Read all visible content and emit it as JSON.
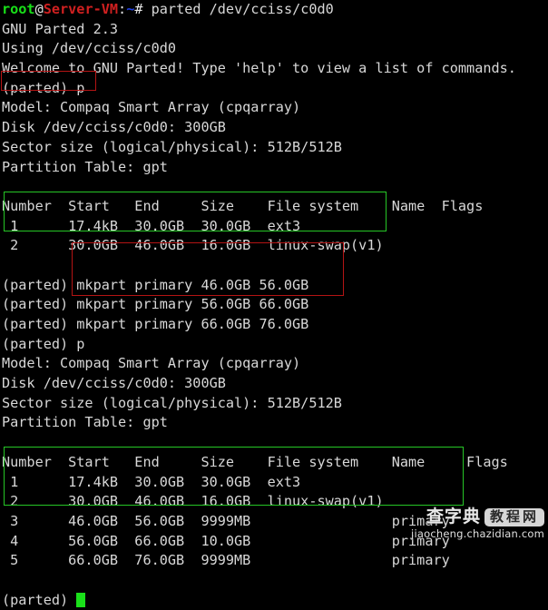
{
  "terminal": {
    "background_color": "#000000",
    "foreground_color": "#d8d8d8",
    "cursor_color": "#1ae01a",
    "prompt": {
      "user": "root",
      "at": "@",
      "host": "Server-VM",
      "colon": ":",
      "path": "~",
      "sigil": "# ",
      "user_color": "#18e018",
      "host_color": "#d02020",
      "path_color": "#2040e0"
    },
    "lines": [
      {
        "id": "l01",
        "type": "prompt",
        "command": "parted /dev/cciss/c0d0"
      },
      {
        "id": "l02",
        "type": "text",
        "text": "GNU Parted 2.3"
      },
      {
        "id": "l03",
        "type": "text",
        "text": "Using /dev/cciss/c0d0"
      },
      {
        "id": "l04",
        "type": "text",
        "text": "Welcome to GNU Parted! Type 'help' to view a list of commands."
      },
      {
        "id": "l05",
        "type": "text",
        "text": "(parted) p"
      },
      {
        "id": "l06",
        "type": "text",
        "text": "Model: Compaq Smart Array (cpqarray)"
      },
      {
        "id": "l07",
        "type": "text",
        "text": "Disk /dev/cciss/c0d0: 300GB"
      },
      {
        "id": "l08",
        "type": "text",
        "text": "Sector size (logical/physical): 512B/512B"
      },
      {
        "id": "l09",
        "type": "text",
        "text": "Partition Table: gpt"
      },
      {
        "id": "l10",
        "type": "text",
        "text": ""
      },
      {
        "id": "l11",
        "type": "text",
        "text": "Number  Start   End     Size    File system    Name  Flags"
      },
      {
        "id": "l12",
        "type": "text",
        "text": " 1      17.4kB  30.0GB  30.0GB  ext3"
      },
      {
        "id": "l13",
        "type": "text",
        "text": " 2      30.0GB  46.0GB  16.0GB  linux-swap(v1)"
      },
      {
        "id": "l14",
        "type": "text",
        "text": ""
      },
      {
        "id": "l15",
        "type": "text",
        "text": "(parted) mkpart primary 46.0GB 56.0GB"
      },
      {
        "id": "l16",
        "type": "text",
        "text": "(parted) mkpart primary 56.0GB 66.0GB"
      },
      {
        "id": "l17",
        "type": "text",
        "text": "(parted) mkpart primary 66.0GB 76.0GB"
      },
      {
        "id": "l18",
        "type": "text",
        "text": "(parted) p"
      },
      {
        "id": "l19",
        "type": "text",
        "text": "Model: Compaq Smart Array (cpqarray)"
      },
      {
        "id": "l20",
        "type": "text",
        "text": "Disk /dev/cciss/c0d0: 300GB"
      },
      {
        "id": "l21",
        "type": "text",
        "text": "Sector size (logical/physical): 512B/512B"
      },
      {
        "id": "l22",
        "type": "text",
        "text": "Partition Table: gpt"
      },
      {
        "id": "l23",
        "type": "text",
        "text": ""
      },
      {
        "id": "l24",
        "type": "text",
        "text": "Number  Start   End     Size    File system    Name     Flags"
      },
      {
        "id": "l25",
        "type": "text",
        "text": " 1      17.4kB  30.0GB  30.0GB  ext3"
      },
      {
        "id": "l26",
        "type": "text",
        "text": " 2      30.0GB  46.0GB  16.0GB  linux-swap(v1)"
      },
      {
        "id": "l27",
        "type": "text",
        "text": " 3      46.0GB  56.0GB  9999MB                 primary"
      },
      {
        "id": "l28",
        "type": "text",
        "text": " 4      56.0GB  66.0GB  10.0GB                 primary"
      },
      {
        "id": "l29",
        "type": "text",
        "text": " 5      66.0GB  76.0GB  9999MB                 primary"
      },
      {
        "id": "l30",
        "type": "text",
        "text": ""
      },
      {
        "id": "l31",
        "type": "cursor_prompt",
        "text": "(parted) "
      }
    ],
    "highlights": [
      {
        "id": "hl-print-command-1",
        "color": "#b41414",
        "label": "red-box-print-command"
      },
      {
        "id": "hl-partition-table-1",
        "color": "#26c626",
        "label": "green-box-existing-partitions"
      },
      {
        "id": "hl-mkpart-commands",
        "color": "#b41414",
        "label": "red-box-mkpart-commands"
      },
      {
        "id": "hl-partition-table-2",
        "color": "#26c626",
        "label": "green-box-new-partitions"
      }
    ]
  },
  "watermark": {
    "main": "查字典",
    "badge": "教程网",
    "url": "jiaocheng.chazidian.com"
  }
}
